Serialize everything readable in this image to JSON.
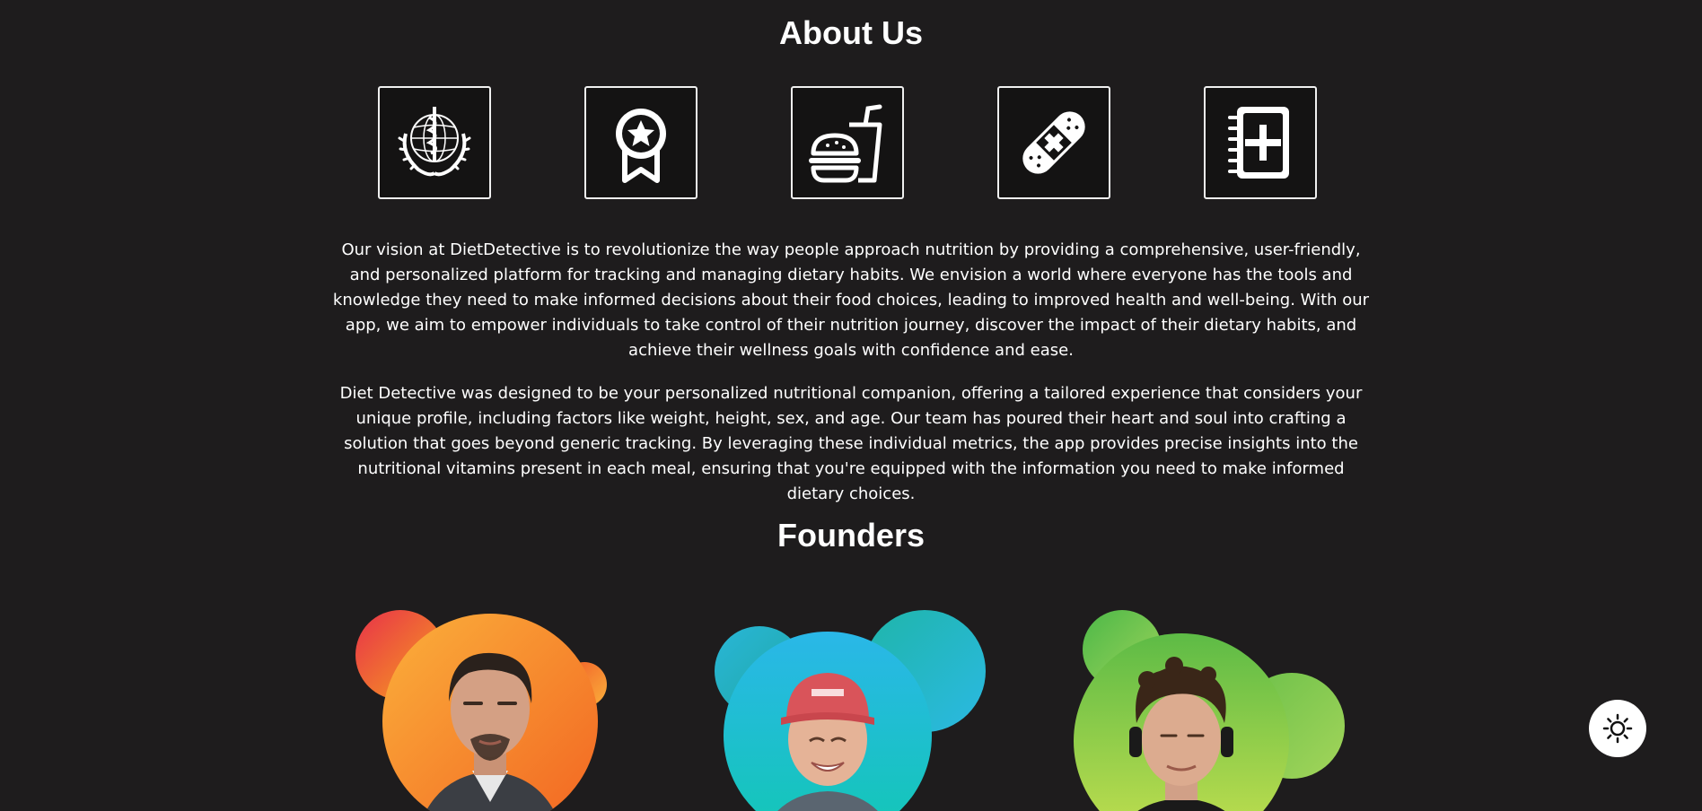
{
  "about": {
    "title": "About Us",
    "icons": [
      "who-emblem-icon",
      "award-ribbon-icon",
      "fast-food-icon",
      "bandage-icon",
      "medical-notebook-icon"
    ],
    "paragraphs": [
      "Our vision at DietDetective is to revolutionize the way people approach nutrition by providing a comprehensive, user-friendly, and personalized platform for tracking and managing dietary habits. We envision a world where everyone has the tools and knowledge they need to make informed decisions about their food choices, leading to improved health and well-being. With our app, we aim to empower individuals to take control of their nutrition journey, discover the impact of their dietary habits, and achieve their wellness goals with confidence and ease.",
      "Diet Detective was designed to be your personalized nutritional companion, offering a tailored experience that considers your unique profile, including factors like weight, height, sex, and age. Our team has poured their heart and soul into crafting a solution that goes beyond generic tracking. By leveraging these individual metrics, the app provides precise insights into the nutritional vitamins present in each meal, ensuring that you're equipped with the information you need to make informed dietary choices."
    ]
  },
  "founders": {
    "title": "Founders",
    "items": [
      {
        "avatar": "founder-1-photo",
        "accent": "#f7941d"
      },
      {
        "avatar": "founder-2-photo",
        "accent": "#29b6d8"
      },
      {
        "avatar": "founder-3-photo",
        "accent": "#7dc242"
      }
    ]
  },
  "theme_toggle": {
    "icon": "sun-icon"
  },
  "colors": {
    "background": "#1e1c1d",
    "text": "#ffffff",
    "toggle_bg": "#ffffff"
  }
}
